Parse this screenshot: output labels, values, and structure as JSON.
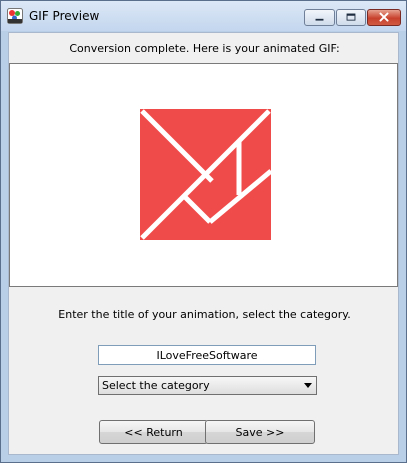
{
  "window": {
    "title": "GIF Preview",
    "icons": [
      "app-gif-icon",
      "minimize-icon",
      "maximize-icon",
      "close-icon"
    ]
  },
  "main": {
    "status_text": "Conversion complete. Here is your animated GIF:",
    "preview_image": "red-tangram-square-gif",
    "instruction_text": "Enter the title of your animation, select the category.",
    "title_input_value": "ILoveFreeSoftware",
    "category_selected": "Select the category"
  },
  "buttons": {
    "return_label": "<<  Return",
    "save_label": "Save >>"
  },
  "colors": {
    "gif_red": "#f04b4b",
    "close_red": "#c7412d"
  }
}
